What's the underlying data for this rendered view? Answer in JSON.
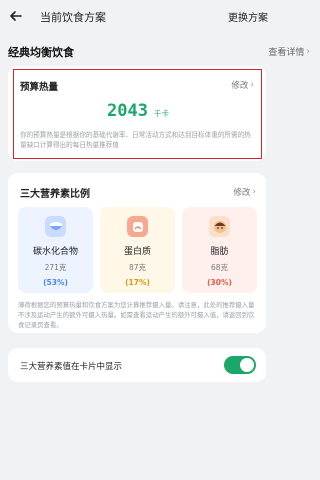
{
  "header": {
    "title": "当前饮食方案",
    "switch_label": "更换方案"
  },
  "plan": {
    "name": "经典均衡饮食",
    "view_detail": "查看详情"
  },
  "budget_card": {
    "label": "预算热量",
    "edit": "修改",
    "kcal": "2043",
    "unit": "千卡",
    "description": "你的预算热量是根据你的基础代谢率、日常活动方式和达到目标体重的所需的热量缺口计算得出的每日热量推荐值"
  },
  "macro_card": {
    "label": "三大营养素比例",
    "edit": "修改",
    "items": [
      {
        "name": "碳水化合物",
        "grams": "271克",
        "percent": "(53%)"
      },
      {
        "name": "蛋白质",
        "grams": "87克",
        "percent": "(17%)"
      },
      {
        "name": "脂肪",
        "grams": "68克",
        "percent": "(30%)"
      }
    ],
    "description": "薄荷根据您的预算热量和饮食方案为您计算推荐摄入量。请注意，此处的推荐摄入量不涉及运动产生的额外可摄入热量。如需查看运动产生的额外可摄入值，请返回到饮食记录页查看。"
  },
  "toggle_card": {
    "label": "三大营养素值在卡片中显示",
    "enabled": true
  },
  "colors": {
    "accent": "#1aa86a",
    "carb": "#4a86e8",
    "protein": "#d79a14",
    "fat": "#e15a4a"
  }
}
